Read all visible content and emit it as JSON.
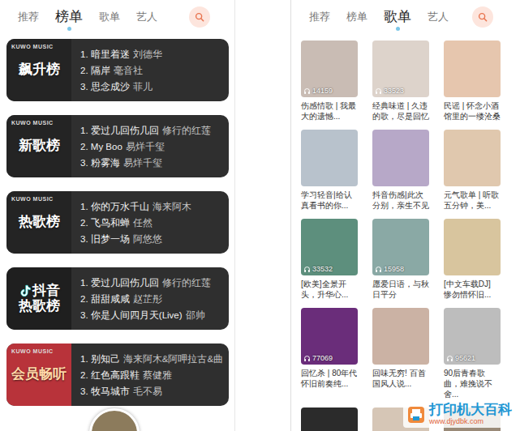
{
  "left": {
    "tabs": [
      {
        "label": "推荐",
        "selected": false
      },
      {
        "label": "榜单",
        "selected": true
      },
      {
        "label": "歌单",
        "selected": false
      },
      {
        "label": "艺人",
        "selected": false
      }
    ],
    "ranks": [
      {
        "kind": "kuwo",
        "logo": "KUWO MUSIC",
        "cover": [
          "飙升榜"
        ],
        "songs": [
          {
            "no": "1.",
            "title": "暗里着迷",
            "artist": "刘德华"
          },
          {
            "no": "2.",
            "title": "隔岸",
            "artist": "毫音社"
          },
          {
            "no": "3.",
            "title": "思念成沙",
            "artist": "菲儿"
          }
        ]
      },
      {
        "kind": "kuwo",
        "logo": "KUWO MUSIC",
        "cover": [
          "新歌榜"
        ],
        "songs": [
          {
            "no": "1.",
            "title": "爱过几回伤几回",
            "artist": "修行的红莲"
          },
          {
            "no": "2.",
            "title": "My Boo",
            "artist": "易烊千玺"
          },
          {
            "no": "3.",
            "title": "粉雾海",
            "artist": "易烊千玺"
          }
        ]
      },
      {
        "kind": "kuwo",
        "logo": "KUWO MUSIC",
        "cover": [
          "热歌榜"
        ],
        "songs": [
          {
            "no": "1.",
            "title": "你的万水千山",
            "artist": "海来阿木"
          },
          {
            "no": "2.",
            "title": "飞鸟和蝉",
            "artist": "任然"
          },
          {
            "no": "3.",
            "title": "旧梦一场",
            "artist": "阿悠悠"
          }
        ]
      },
      {
        "kind": "douyin",
        "cover": [
          "抖音",
          "热歌榜"
        ],
        "songs": [
          {
            "no": "1.",
            "title": "爱过几回伤几回",
            "artist": "修行的红莲"
          },
          {
            "no": "2.",
            "title": "甜甜咸咸",
            "artist": "赵芷彤"
          },
          {
            "no": "3.",
            "title": "你是人间四月天(Live)",
            "artist": "邵帅"
          }
        ]
      },
      {
        "kind": "vip",
        "logo": "KUWO MUSIC",
        "cover": [
          "会员畅听"
        ],
        "songs": [
          {
            "no": "1.",
            "title": "别知己",
            "artist": "海来阿木&阿呷拉古&曲"
          },
          {
            "no": "2.",
            "title": "红色高跟鞋",
            "artist": "蔡健雅"
          },
          {
            "no": "3.",
            "title": "牧马城市",
            "artist": "毛不易"
          }
        ]
      }
    ]
  },
  "right": {
    "tabs": [
      {
        "label": "推荐",
        "selected": false
      },
      {
        "label": "榜单",
        "selected": false
      },
      {
        "label": "歌单",
        "selected": true
      },
      {
        "label": "艺人",
        "selected": false
      }
    ],
    "playlists": [
      {
        "title": "伤感情歌 | 我最大的遗憾...",
        "count": "14159"
      },
      {
        "title": "经典味道 | 久违的歌，尽是回忆",
        "count": "33523"
      },
      {
        "title": "民谣 | 怀念小酒馆里的一缕沧桑"
      },
      {
        "title": "学习轻音|给认真看书的你..."
      },
      {
        "title": "抖音伤感|此次分别，亲生不见"
      },
      {
        "title": "元气歌单 | 听歌五分钟，美..."
      },
      {
        "title": "[欧美]全景开头，升华心...",
        "count": "33532"
      },
      {
        "title": "愿爱日语，与秋日平分",
        "count": "15958"
      },
      {
        "title": "[中文车载DJ] 惨勿惜怀旧..."
      },
      {
        "title": "回忆杀 | 80年代怀旧前奏纯...",
        "count": "77069"
      },
      {
        "title": "回味无穷! 百首国风人说..."
      },
      {
        "title": "90后青春歌曲，难挽说不舍...",
        "count": "95621"
      },
      {},
      {},
      {}
    ]
  },
  "watermark": {
    "title": "打印机大百科",
    "url": "www.djydbk.com"
  }
}
